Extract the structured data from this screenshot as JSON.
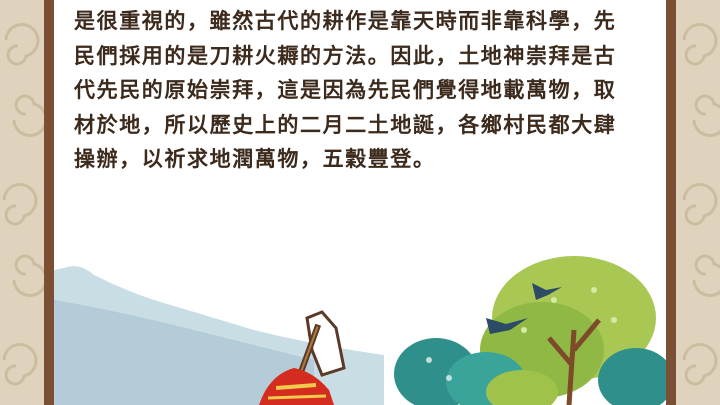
{
  "article": {
    "lines": [
      "是很重視的，雖然古代的耕作是靠天時而非靠科學，先",
      "民們採用的是刀耕火耨的方法。因此，土地神崇拜是古",
      "代先民的原始崇拜，這是因為先民們覺得地載萬物，取",
      "材於地，所以歷史上的二月二土地誕，各鄉村民都大肆",
      "操辦，以祈求地潤萬物，五穀豐登。"
    ]
  },
  "colors": {
    "background": "#dfd3bd",
    "frame": "#7a4f34",
    "paper": "#ffffff",
    "text": "#3c2a1c",
    "mountain": "#c9dde5",
    "tree_green": "#9fc34a",
    "tree_teal": "#2f8f8a",
    "bird": "#2d4a66"
  },
  "illustration": {
    "icons": [
      "swirl-pattern-icon",
      "mountain-icon",
      "tree-icon",
      "swallow-icon",
      "hoe-icon",
      "earth-god-robe-icon"
    ]
  }
}
